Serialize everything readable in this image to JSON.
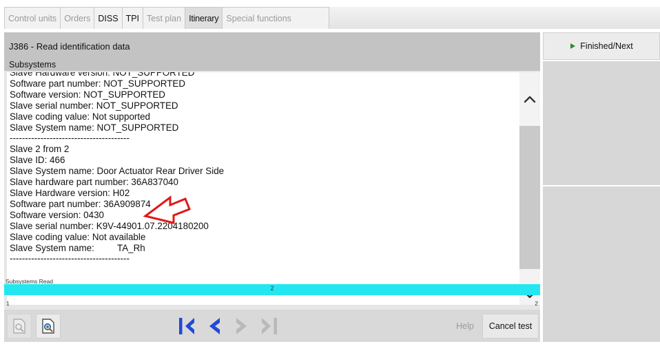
{
  "tabs": [
    {
      "label": "Control units",
      "style": "dim"
    },
    {
      "label": "Orders",
      "style": "dim"
    },
    {
      "label": "DISS",
      "style": "dark"
    },
    {
      "label": "TPI",
      "style": "dark"
    },
    {
      "label": "Test plan",
      "style": "dim"
    },
    {
      "label": "Itinerary",
      "style": "active"
    },
    {
      "label": "Special functions",
      "style": "dim"
    }
  ],
  "header": {
    "title": "J386 - Read identification data",
    "subtitle": "Subsystems"
  },
  "output_lines": [
    "Slave Hardware version: NOT_SUPPORTED",
    "Software part number: NOT_SUPPORTED",
    "Software version: NOT_SUPPORTED",
    "Slave serial number: NOT_SUPPORTED",
    "Slave coding value: Not supported",
    "Slave System name: NOT_SUPPORTED",
    "---------------------------------------",
    "Slave 2 from 2",
    "Slave ID: 466",
    "Slave System name: Door Actuator Rear Driver Side",
    "Slave hardware part number: 36A837040",
    "Slave Hardware version: H02",
    "Software part number: 36A909874",
    "Software version: 0430",
    "Slave serial number: K9V-44901.07.2204180200",
    "Slave coding value: Not available",
    "Slave System name:         TA_Rh",
    "---------------------------------------"
  ],
  "progress": {
    "label": "Subsystems Read",
    "value": "2",
    "fraction": 1.0,
    "scale_min": "1",
    "scale_max": "2"
  },
  "footer": {
    "help_label": "Help",
    "cancel_label": "Cancel test"
  },
  "side": {
    "finished_label": "Finished/Next"
  },
  "colors": {
    "progress_fill": "#23e7f0",
    "nav_active": "#1f49d6",
    "nav_disabled": "#b9b9b9",
    "play_arrow": "#2a8a2a",
    "annotation_arrow": "#e01818"
  }
}
